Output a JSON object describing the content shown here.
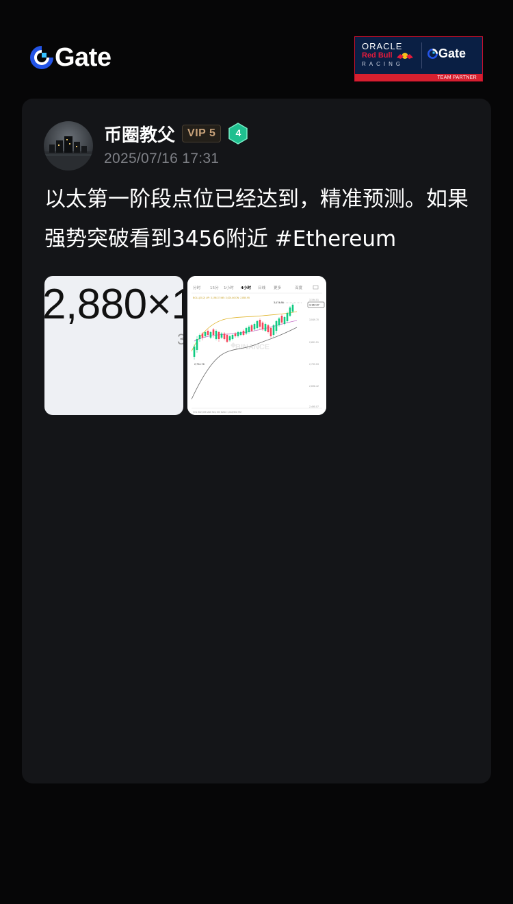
{
  "header": {
    "logo_text": "Gate",
    "partner": {
      "oracle": "ORACLE",
      "redbull": "Red Bull",
      "racing": "RACING",
      "gate": "Gate",
      "tag": "TEAM PARTNER"
    }
  },
  "post": {
    "author": "币圈教父",
    "vip": "VIP 5",
    "level": "4",
    "timestamp": "2025/07/16 17:31",
    "text": "以太第一阶段点位已经达到，精准预测。如果强势突破看到3456附近 ",
    "hashtag": "#Ethereum",
    "images": [
      {
        "big_text": "2,880×1",
        "small_text": "3"
      },
      {
        "tabs": [
          "分时",
          "15分",
          "1小时",
          "4小时",
          "日线",
          "更多",
          "深度"
        ],
        "active_tab": "4小时",
        "indicator_line": "BOLL(20,2) UP: 3,198.37  MB: 3,024.66  DN: 2,850.95",
        "price_labels": [
          "3,194.01",
          "3,162.87",
          "3,049.70",
          "2,891.51",
          "2,799.53",
          "2,698.42",
          "2,495.07"
        ],
        "high_label": "3,174.86",
        "low_label": "2,794.78",
        "current_price": "3,162.87",
        "watermark": "BINANCE",
        "volume_line": "VOL 982,393  MA5 924,193  MA10 1,118,902.792"
      }
    ]
  },
  "colors": {
    "background": "#060607",
    "card": "#141518",
    "gate_blue": "#2354e6",
    "level_badge": "#1fbf8f",
    "vip_gold": "#c8a27a",
    "timestamp_gray": "#7f8187",
    "candle_up": "#0ecb81",
    "candle_down": "#f6465d"
  },
  "icons": {
    "logo": "gate-logo-icon",
    "level": "hexagon-level-icon",
    "bull": "red-bull-icon"
  }
}
